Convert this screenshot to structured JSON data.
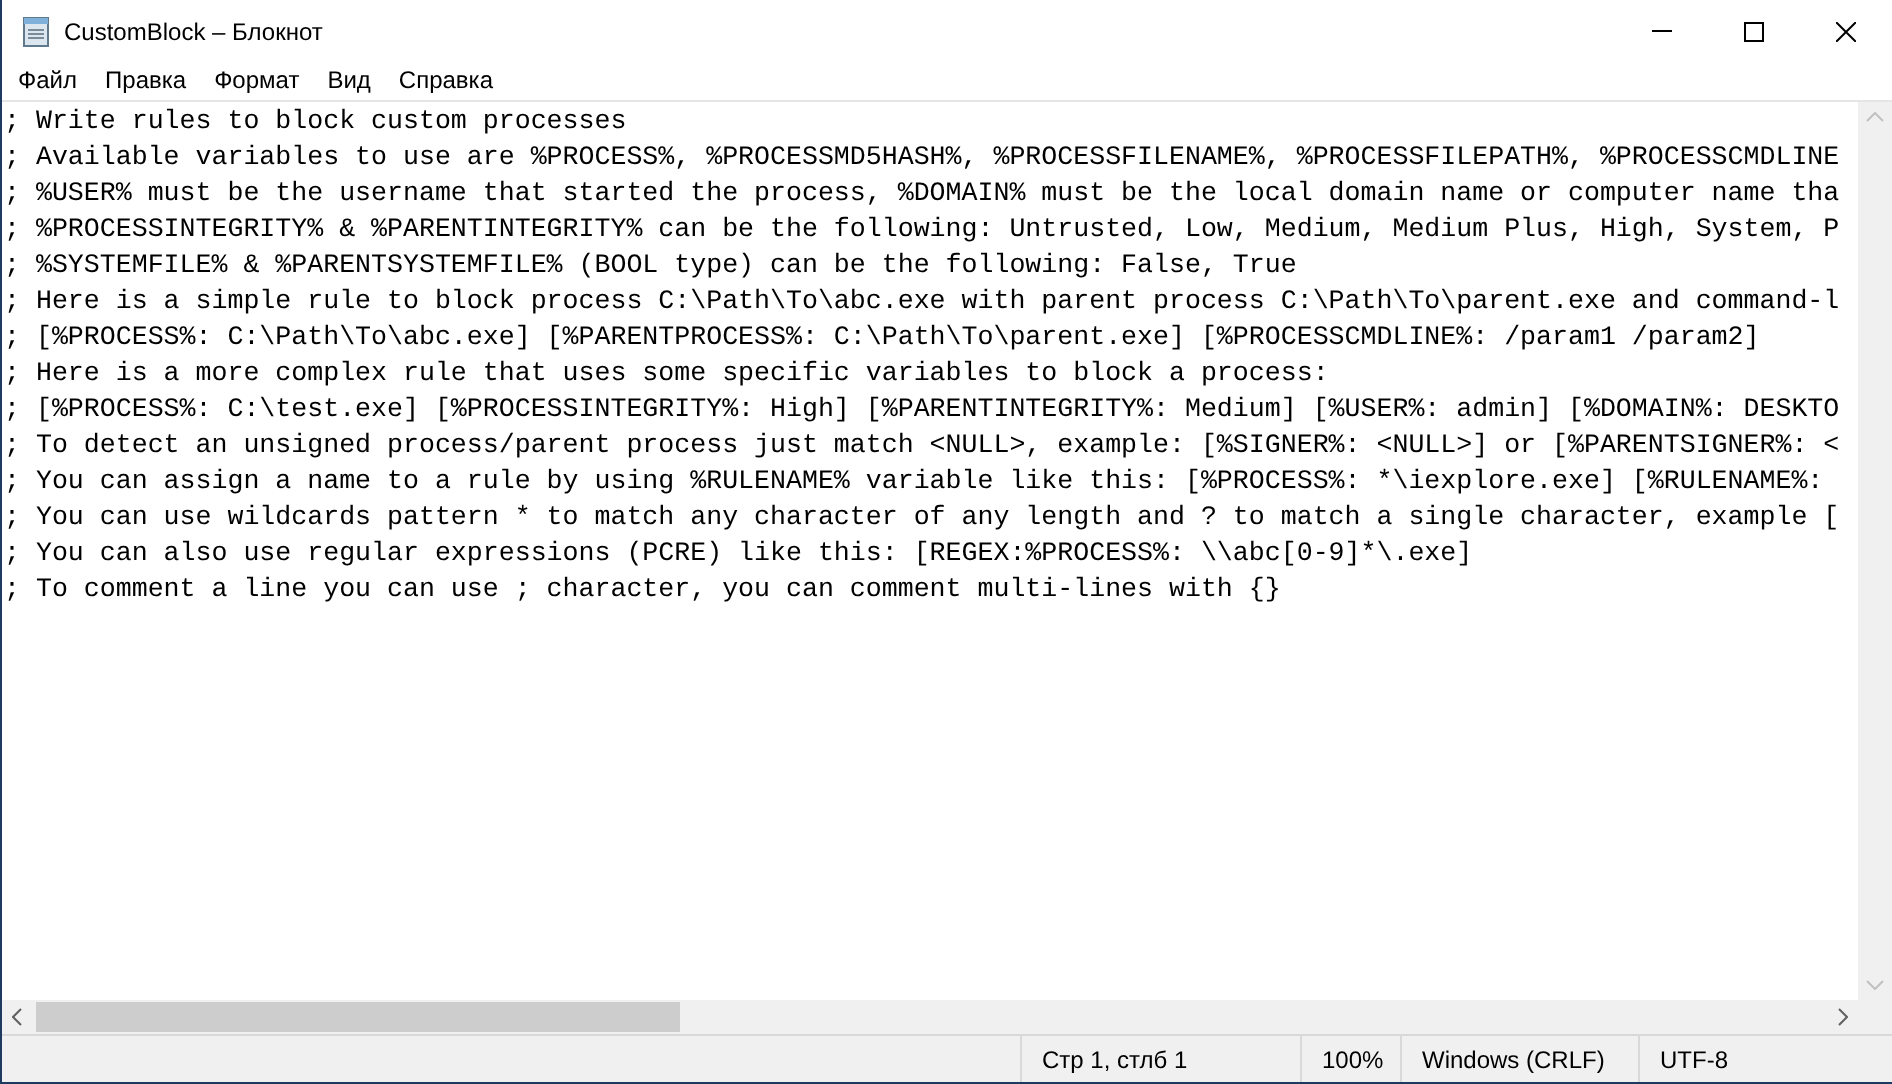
{
  "window": {
    "title": "CustomBlock – Блокнот"
  },
  "menu": [
    "Файл",
    "Правка",
    "Формат",
    "Вид",
    "Справка"
  ],
  "editor": {
    "lines": [
      "; Write rules to block custom processes",
      "; Available variables to use are %PROCESS%, %PROCESSMD5HASH%, %PROCESSFILENAME%, %PROCESSFILEPATH%, %PROCESSCMDLINE",
      "; %USER% must be the username that started the process, %DOMAIN% must be the local domain name or computer name tha",
      "; %PROCESSINTEGRITY% & %PARENTINTEGRITY% can be the following: Untrusted, Low, Medium, Medium Plus, High, System, P",
      "; %SYSTEMFILE% & %PARENTSYSTEMFILE% (BOOL type) can be the following: False, True",
      "; Here is a simple rule to block process C:\\Path\\To\\abc.exe with parent process C:\\Path\\To\\parent.exe and command-l",
      "; [%PROCESS%: C:\\Path\\To\\abc.exe] [%PARENTPROCESS%: C:\\Path\\To\\parent.exe] [%PROCESSCMDLINE%: /param1 /param2]",
      "; Here is a more complex rule that uses some specific variables to block a process:",
      "; [%PROCESS%: C:\\test.exe] [%PROCESSINTEGRITY%: High] [%PARENTINTEGRITY%: Medium] [%USER%: admin] [%DOMAIN%: DESKTO",
      "; To detect an unsigned process/parent process just match <NULL>, example: [%SIGNER%: <NULL>] or [%PARENTSIGNER%: <",
      "; You can assign a name to a rule by using %RULENAME% variable like this: [%PROCESS%: *\\iexplore.exe] [%RULENAME%:",
      "; You can use wildcards pattern * to match any character of any length and ? to match a single character, example [",
      "; You can also use regular expressions (PCRE) like this: [REGEX:%PROCESS%: \\\\abc[0-9]*\\.exe]",
      "; To comment a line you can use ; character, you can comment multi-lines with {}"
    ]
  },
  "status_bar": [
    "Стр 1, стлб 1",
    "100%",
    "Windows (CRLF)",
    "UTF-8"
  ]
}
